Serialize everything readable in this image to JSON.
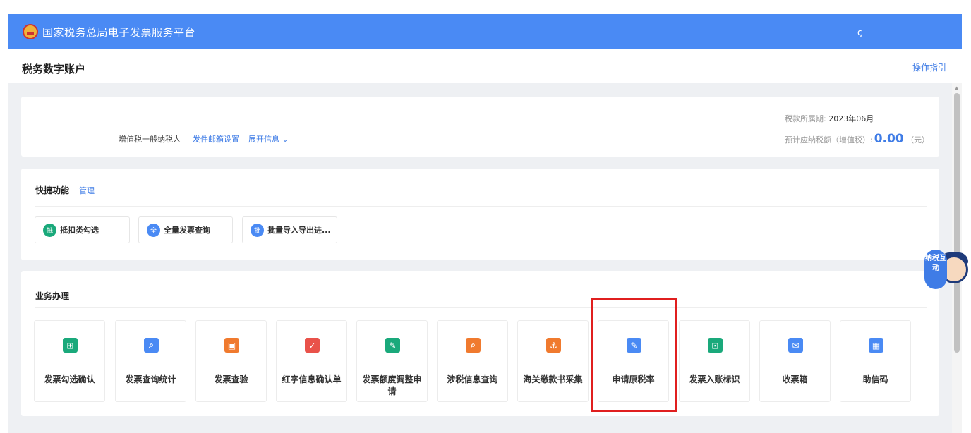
{
  "header": {
    "title": "国家税务总局电子发票服务平台",
    "user_icon": "ꞔ"
  },
  "page": {
    "title": "税务数字账户",
    "guide_link": "操作指引"
  },
  "taxpayer": {
    "type": "增值税一般纳税人",
    "mail_settings": "发件邮箱设置",
    "expand_info": "展开信息",
    "period_label": "税款所属期:",
    "period_value": "2023年06月",
    "estimate_label": "预计应纳税额（增值税）:",
    "estimate_value": "0.00",
    "estimate_unit": "（元）"
  },
  "quick": {
    "title": "快捷功能",
    "manage": "管理",
    "items": [
      {
        "badge": "抵",
        "label": "抵扣类勾选",
        "color": "#1aa97b"
      },
      {
        "badge": "全",
        "label": "全量发票查询",
        "color": "#4a8af4"
      },
      {
        "badge": "批",
        "label": "批量导入导出进...",
        "color": "#4a8af4"
      }
    ]
  },
  "business": {
    "title": "业务办理",
    "items": [
      {
        "label": "发票勾选确认",
        "icon": "invoice-check-icon",
        "color": "#1aa97b",
        "glyph": "⊞"
      },
      {
        "label": "发票查询统计",
        "icon": "invoice-search-icon",
        "color": "#4a8af4",
        "glyph": "⌕"
      },
      {
        "label": "发票查验",
        "icon": "invoice-verify-icon",
        "color": "#f07a2e",
        "glyph": "▣"
      },
      {
        "label": "红字信息确认单",
        "icon": "red-letter-icon",
        "color": "#e9524a",
        "glyph": "✓"
      },
      {
        "label": "发票额度调整申请",
        "icon": "quota-adjust-icon",
        "color": "#1aa97b",
        "glyph": "✎"
      },
      {
        "label": "涉税信息查询",
        "icon": "tax-info-search-icon",
        "color": "#f07a2e",
        "glyph": "⌕"
      },
      {
        "label": "海关缴款书采集",
        "icon": "customs-payment-icon",
        "color": "#f07a2e",
        "glyph": "⚓"
      },
      {
        "label": "申请原税率",
        "icon": "original-tax-rate-icon",
        "color": "#4a8af4",
        "glyph": "✎"
      },
      {
        "label": "发票入账标识",
        "icon": "invoice-account-icon",
        "color": "#1aa97b",
        "glyph": "⊡"
      },
      {
        "label": "收票箱",
        "icon": "mailbox-icon",
        "color": "#4a8af4",
        "glyph": "✉"
      },
      {
        "label": "助信码",
        "icon": "qr-code-icon",
        "color": "#4a8af4",
        "glyph": "▦"
      }
    ]
  },
  "mascot": {
    "text": "纳税互动"
  }
}
